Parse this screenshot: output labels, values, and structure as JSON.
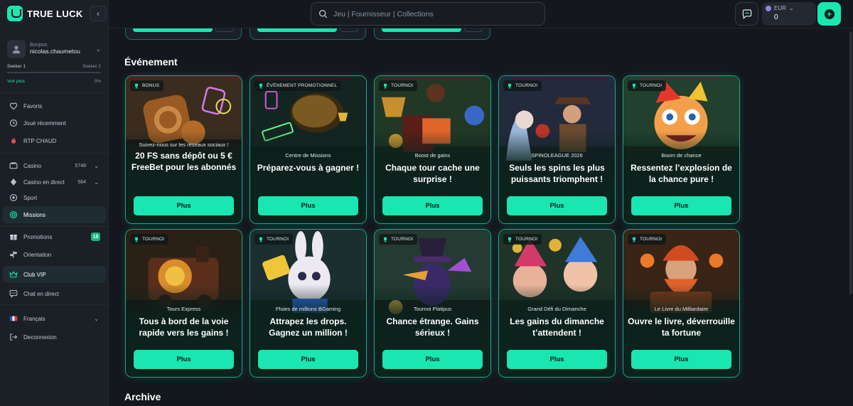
{
  "brand": {
    "name": "TRUE LUCK"
  },
  "user": {
    "greeting": "Bonjour,",
    "name": "nicolas.chaumetou"
  },
  "level": {
    "current": "Seeker 1",
    "next": "Seeker 2",
    "voir_plus": "Voir plus",
    "progress_text": "0%",
    "progress": 0
  },
  "sidebar": {
    "items": [
      {
        "label": "Favoris",
        "icon": "heart-icon"
      },
      {
        "label": "Joué récemment",
        "icon": "clock-icon"
      },
      {
        "label": "RTP CHAUD",
        "icon": "fire-icon"
      },
      {
        "label": "Casino",
        "icon": "casino-icon",
        "count": "5748"
      },
      {
        "label": "Casino en direct",
        "icon": "live-casino-icon",
        "count": "564"
      },
      {
        "label": "Sport",
        "icon": "sport-icon"
      },
      {
        "label": "Missions",
        "icon": "missions-icon"
      },
      {
        "label": "Promotions",
        "icon": "gift-icon",
        "badge": "15"
      },
      {
        "label": "Orientation",
        "icon": "signpost-icon"
      },
      {
        "label": "Club VIP",
        "icon": "crown-icon"
      },
      {
        "label": "Chat en direct",
        "icon": "chat-icon"
      },
      {
        "label": "Français",
        "icon": "flag-icon"
      },
      {
        "label": "Deconnexion",
        "icon": "logout-icon"
      }
    ]
  },
  "search": {
    "placeholder": "Jeu | Fournisseur | Collections"
  },
  "wallet": {
    "currency": "EUR",
    "amount": "0"
  },
  "sections": {
    "event_title": "Événement",
    "archive_title": "Archive"
  },
  "cards": [
    {
      "badge": "BONUS",
      "subtitle": "Suivez-nous sur les réseaux sociaux !",
      "headline": "20 FS sans dépôt ou 5 € FreeBet pour les abonnés",
      "button": "Plus"
    },
    {
      "badge": "ÉVÉNEMENT PROMOTIONNEL",
      "subtitle": "Centre de Missions",
      "headline": "Préparez-vous à gagner !",
      "button": "Plus"
    },
    {
      "badge": "TOURNOI",
      "subtitle": "Boost de gains",
      "headline": "Chaque tour cache une surprise !",
      "button": "Plus"
    },
    {
      "badge": "TOURNOI",
      "subtitle": "SPINOLEAGUE 2026",
      "headline": "Seuls les spins les plus puissants triomphent !",
      "button": "Plus"
    },
    {
      "badge": "TOURNOI",
      "subtitle": "Boom de chance",
      "headline": "Ressentez l’explosion de la chance pure !",
      "button": "Plus"
    },
    {
      "badge": "TOURNOI",
      "subtitle": "Tours Express",
      "headline": "Tous à bord de la voie rapide vers les gains !",
      "button": "Plus"
    },
    {
      "badge": "TOURNOI",
      "subtitle": "Pluies de millions BGaming",
      "headline": "Attrapez les drops. Gagnez un million !",
      "button": "Plus"
    },
    {
      "badge": "TOURNOI",
      "subtitle": "Tournoi Platipus",
      "headline": "Chance étrange. Gains sérieux !",
      "button": "Plus"
    },
    {
      "badge": "TOURNOI",
      "subtitle": "Grand Défi du Dimanche",
      "headline": "Les gains du dimanche t’attendent !",
      "button": "Plus"
    },
    {
      "badge": "TOURNOI",
      "subtitle": "Le Livre du Milliardaire",
      "headline": "Ouvre le livre, déverrouille ta fortune",
      "button": "Plus"
    }
  ],
  "colors": {
    "accent": "#19e6b0",
    "background": "#14171d",
    "sidebar": "#1b1f26",
    "card_border": "#1fa48c"
  }
}
